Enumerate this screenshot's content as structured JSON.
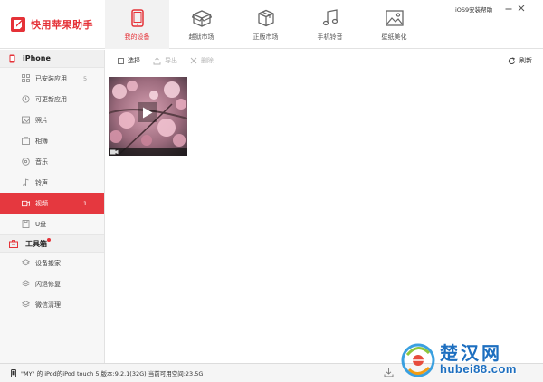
{
  "app": {
    "title": "快用苹果助手",
    "help_link": "iOS9安装帮助"
  },
  "nav": {
    "tabs": [
      {
        "label": "我的设备",
        "icon": "phone-icon",
        "active": true
      },
      {
        "label": "越狱市场",
        "icon": "box-open-icon",
        "active": false
      },
      {
        "label": "正版市场",
        "icon": "package-icon",
        "active": false
      },
      {
        "label": "手机铃音",
        "icon": "music-note-icon",
        "active": false
      },
      {
        "label": "壁纸美化",
        "icon": "picture-icon",
        "active": false
      }
    ]
  },
  "sidebar": {
    "device_section": "iPhone",
    "items": [
      {
        "label": "已安装应用",
        "count": "5",
        "icon": "grid-icon"
      },
      {
        "label": "可更新应用",
        "count": "",
        "icon": "refresh-icon"
      },
      {
        "label": "照片",
        "count": "",
        "icon": "photo-icon"
      },
      {
        "label": "相簿",
        "count": "",
        "icon": "album-icon"
      },
      {
        "label": "音乐",
        "count": "",
        "icon": "music-icon"
      },
      {
        "label": "铃声",
        "count": "",
        "icon": "ringtone-icon"
      },
      {
        "label": "视频",
        "count": "1",
        "icon": "video-icon",
        "active": true
      },
      {
        "label": "U盘",
        "count": "",
        "icon": "usb-icon"
      }
    ],
    "tools_section": "工具箱",
    "tools": [
      {
        "label": "设备搬家",
        "icon": "layers-icon"
      },
      {
        "label": "闪退修复",
        "icon": "layers-icon"
      },
      {
        "label": "微信清理",
        "icon": "layers-icon"
      }
    ]
  },
  "toolbar": {
    "select_label": "选择",
    "export_label": "导出",
    "delete_label": "删除",
    "refresh_label": "刷新"
  },
  "status": {
    "text": "\"MY\" 的 iPod的iPod touch 5   版本:9.2.1(32G)   当前可用空间:23.5G"
  },
  "watermark": {
    "brand": "楚汉网",
    "url": "hubei88.com"
  },
  "colors": {
    "accent": "#e53238",
    "active_bg": "#e5383f",
    "sidebar_bg": "#f7f7f7"
  }
}
